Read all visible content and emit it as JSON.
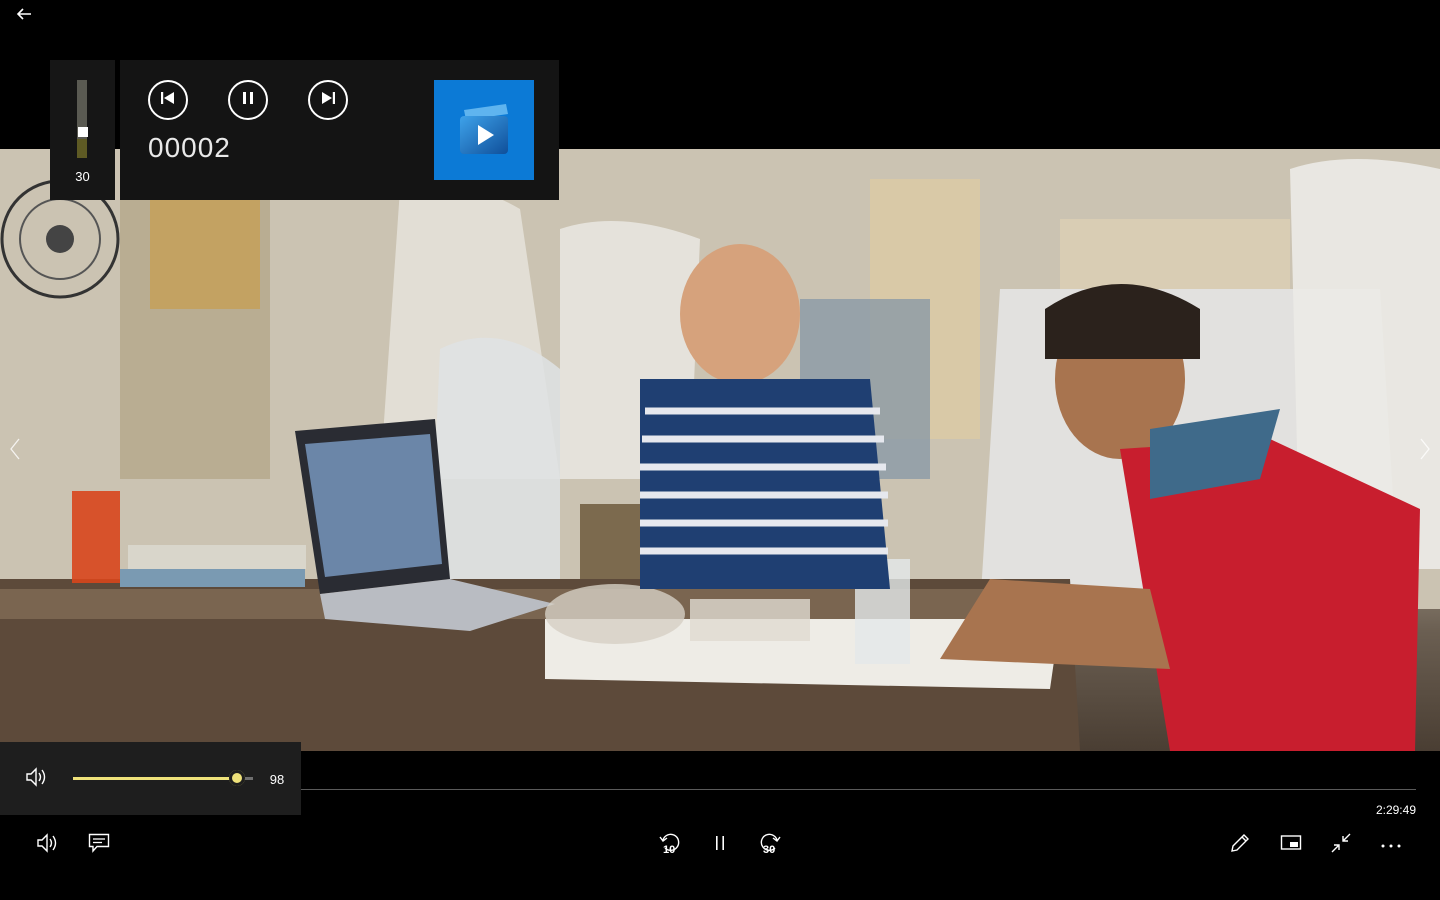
{
  "app": {
    "name": "Films & TV",
    "accent": "#0c7ad6"
  },
  "mini_player": {
    "volume": 30,
    "volume_label": "30",
    "title": "00002",
    "buttons": {
      "previous": "skip-previous-icon",
      "pause": "pause-icon",
      "next": "skip-next-icon"
    },
    "app_icon": "films-tv-app-icon"
  },
  "volume_flyout": {
    "icon": "speaker-icon",
    "value": 98,
    "value_label": "98",
    "fill_color": "#efe27a"
  },
  "seek": {
    "progress": 0.0,
    "total_time": "2:29:49"
  },
  "controls": {
    "left": [
      "volume-icon",
      "subtitles-icon"
    ],
    "center": {
      "rewind_label": "10",
      "pause": "pause-icon",
      "forward_label": "30"
    },
    "right": [
      "edit-pen-icon",
      "mini-view-icon",
      "exit-fullscreen-icon",
      "more-options-icon"
    ]
  },
  "nav": {
    "back": "back-arrow-icon",
    "prev": "chevron-left-icon",
    "next": "chevron-right-icon"
  }
}
